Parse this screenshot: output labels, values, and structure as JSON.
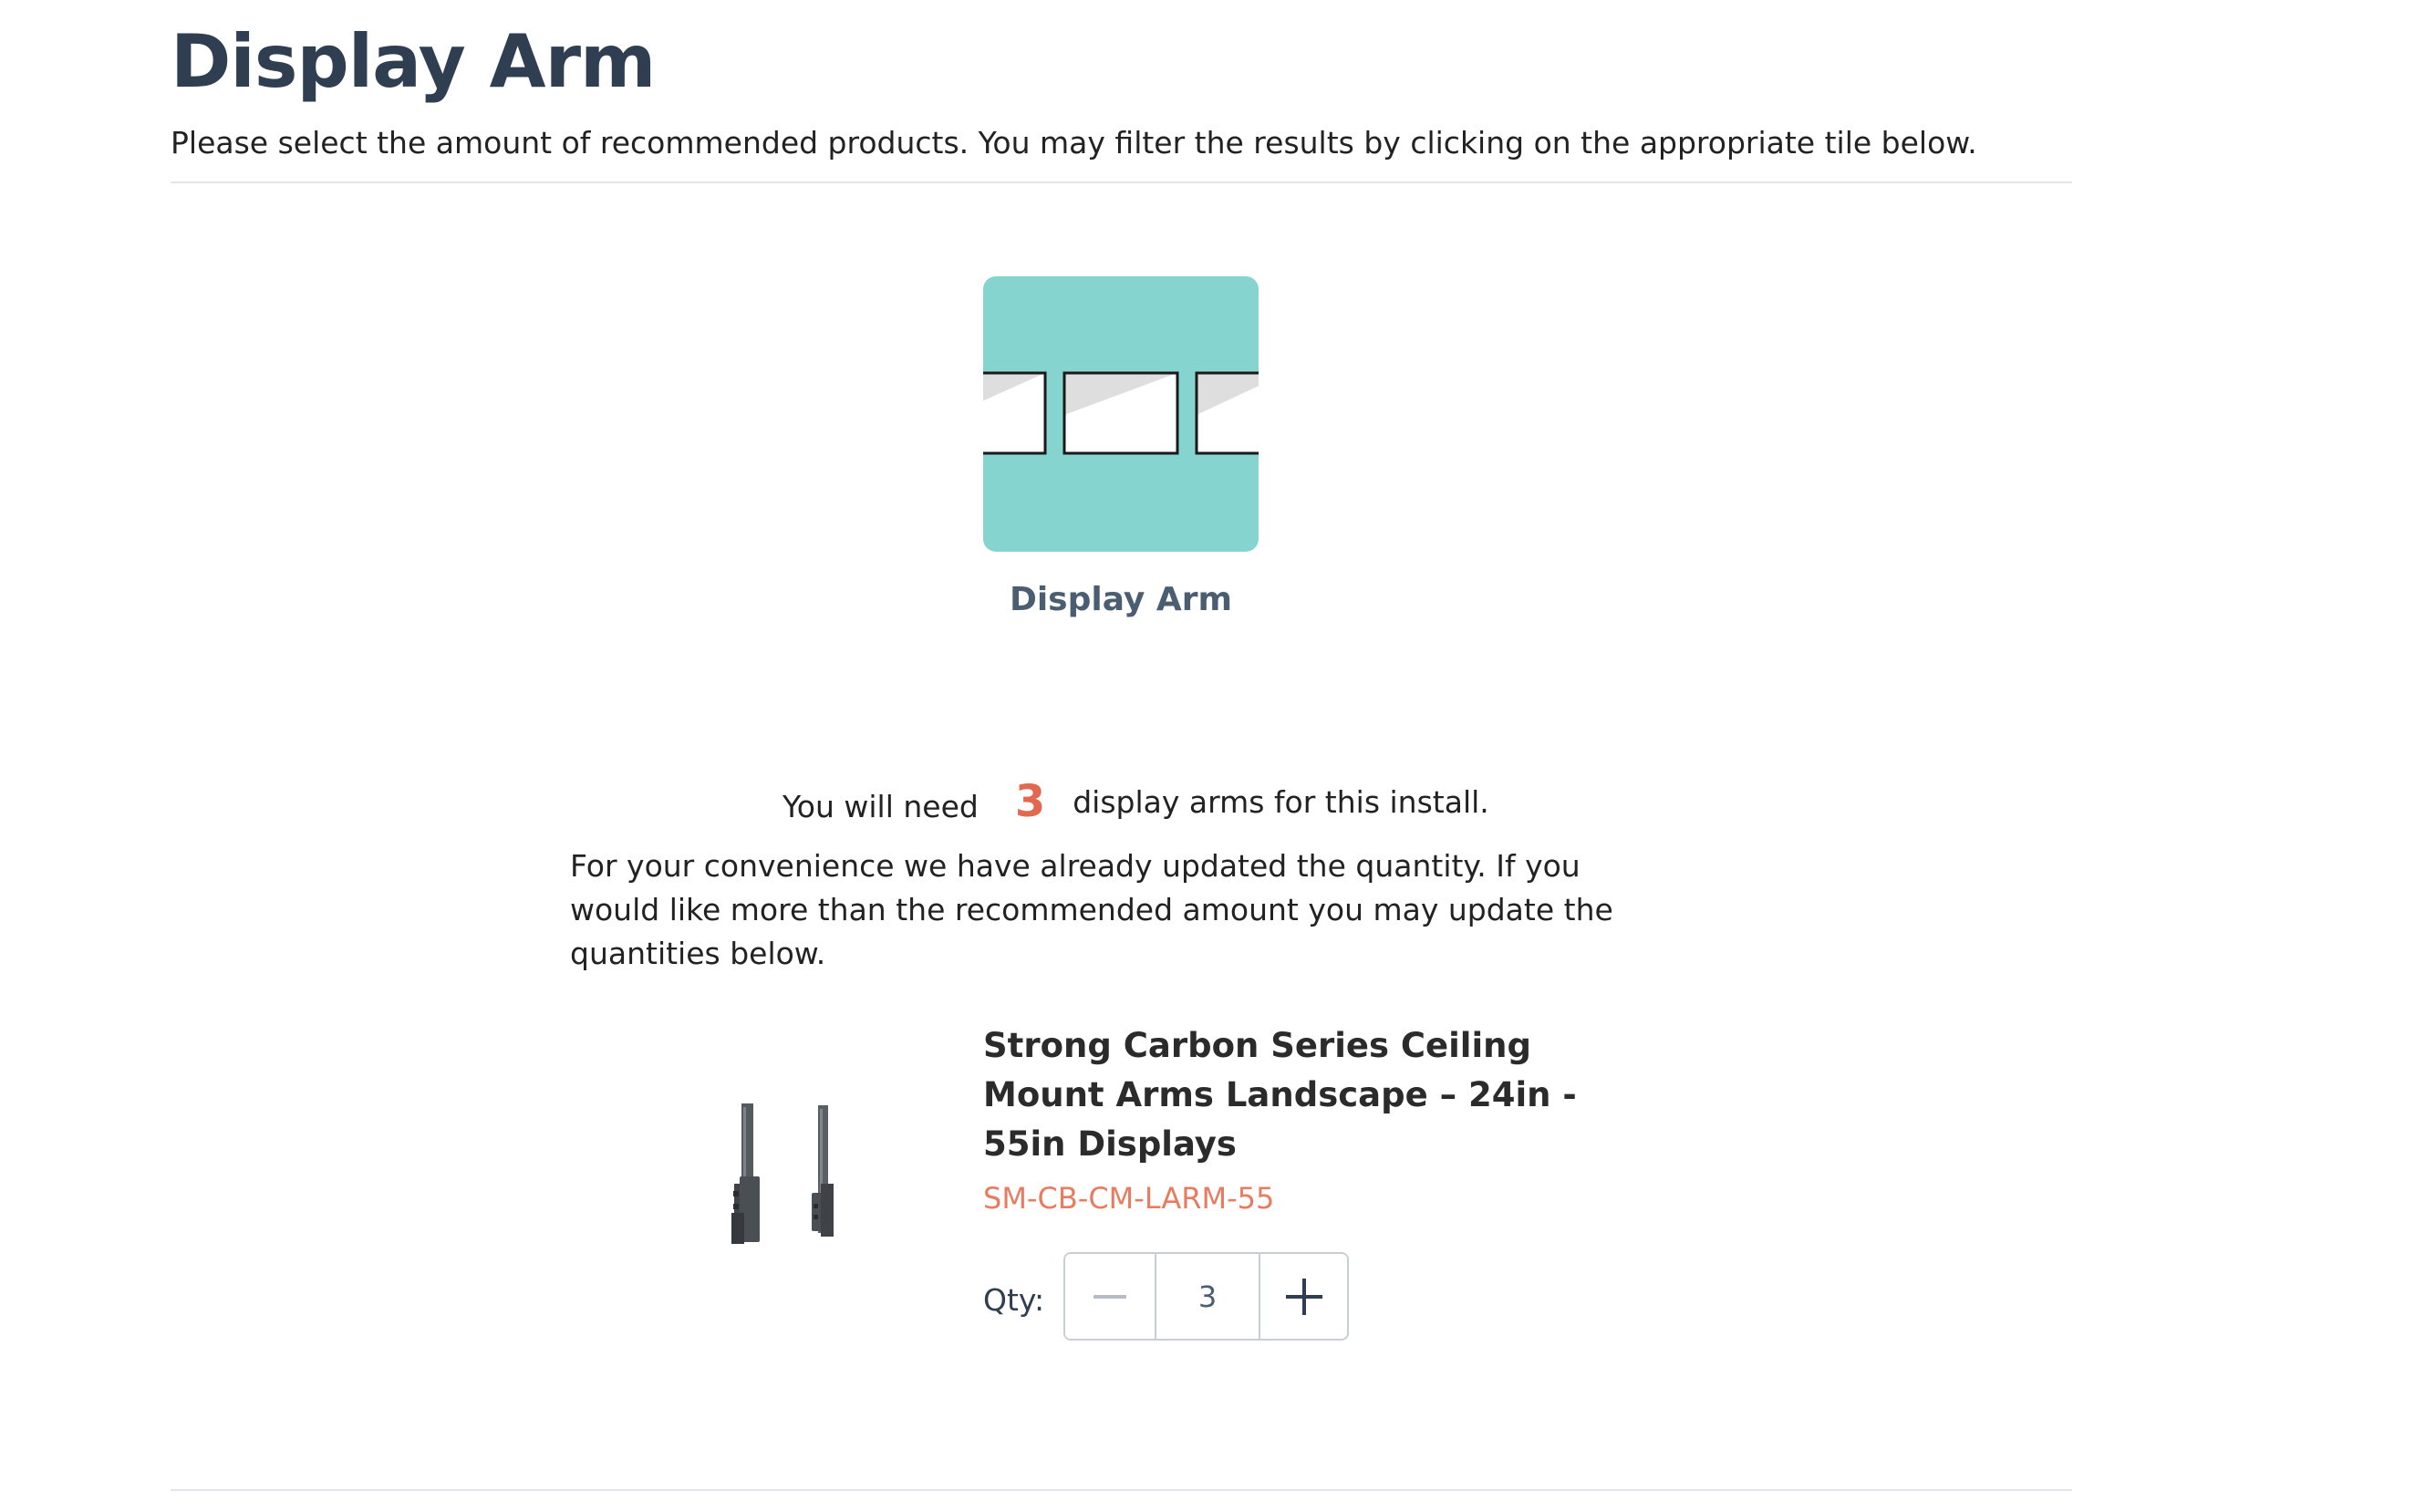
{
  "header": {
    "title": "Display Arm",
    "intro": "Please select the amount of recommended products. You may filter the results by clicking on the appropriate tile below."
  },
  "filter_tile": {
    "label": "Display Arm",
    "icon": "three-displays-icon",
    "color": "#85d4cf"
  },
  "recommendation": {
    "prefix": "You will need",
    "count": "3",
    "suffix": "display arms for this install.",
    "note": "For your convenience we have already updated the quantity. If you would like more than the recommended amount you may update the quantities below."
  },
  "product": {
    "name": "Strong Carbon Series Ceiling Mount Arms Landscape – 24in - 55in Displays",
    "sku": "SM-CB-CM-LARM-55",
    "image_icon": "ceiling-mount-arms-image",
    "qty_label": "Qty:",
    "quantity": "3"
  },
  "colors": {
    "accent": "#e0694f",
    "sku": "#e87c60",
    "title": "#2f3e50",
    "tile": "#85d4cf"
  }
}
